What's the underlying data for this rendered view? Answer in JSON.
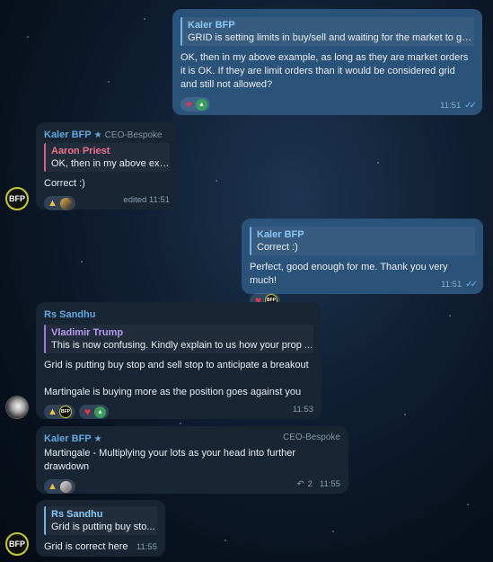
{
  "messages": [
    {
      "id": "m1",
      "quote_name": "Kaler BFP",
      "quote_text": "GRID is setting limits in  buy/sell and waiting for the market to go...",
      "text": "OK, then in my above example, as long as they are market orders it is OK. If they are limit orders than it would be considered grid and still not allowed?",
      "time": "11:51"
    },
    {
      "id": "m2",
      "sender": "Kaler BFP",
      "role": "CEO-Bespoke",
      "quote_name": "Aaron Priest",
      "quote_text": "OK, then in my above exa...",
      "text": "Correct :)",
      "time": "edited 11:51"
    },
    {
      "id": "m3",
      "quote_name": "Kaler BFP",
      "quote_text": "Correct :)",
      "text": "Perfect, good enough for me. Thank you very much!",
      "time": "11:51"
    },
    {
      "id": "m4",
      "sender": "Rs Sandhu",
      "quote_name": "Vladimir Trump",
      "quote_text": "This is now confusing. Kindly explain to us how your prop ...",
      "text_line1": "Grid is putting buy stop and sell stop to anticipate  a breakout",
      "text_line2": "Martingale is buying more as the position goes against you",
      "time": "11:53"
    },
    {
      "id": "m5",
      "sender": "Kaler BFP",
      "role": "CEO-Bespoke",
      "text": "Martingale - Multiplying your lots as your head into further drawdown",
      "replies": "2",
      "time": "11:55"
    },
    {
      "id": "m6",
      "sender": "Rs Sandhu",
      "quote_name": "Rs Sandhu",
      "quote_text": "Grid is putting buy sto...",
      "text": "Grid is correct here",
      "time": "11:55"
    }
  ],
  "avatar_bfp_text": "BFP",
  "icons": {
    "heart": "♥",
    "bell": "🔔",
    "thumb": "👍",
    "star": "★",
    "ticks": "✓✓",
    "reply": "↶"
  },
  "colors": {
    "outgoing_bubble": "#2b5278",
    "incoming_bubble": "#182533",
    "accent_blue": "#62a8e0"
  }
}
